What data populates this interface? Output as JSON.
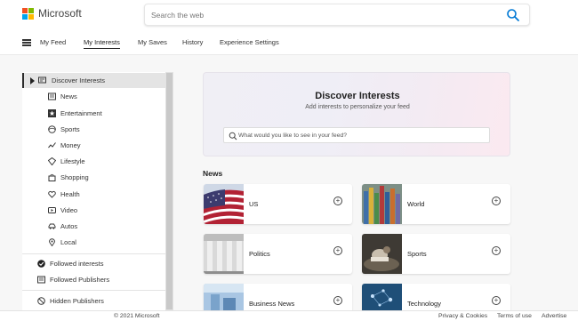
{
  "header": {
    "brand": "Microsoft",
    "search_placeholder": "Search the web"
  },
  "nav": {
    "items": [
      {
        "label": "My Feed",
        "active": false
      },
      {
        "label": "My Interests",
        "active": true
      },
      {
        "label": "My Saves",
        "active": false
      },
      {
        "label": "History",
        "active": false
      },
      {
        "label": "Experience Settings",
        "active": false
      }
    ]
  },
  "sidebar": {
    "items": [
      {
        "label": "Discover Interests",
        "icon": "discover-icon",
        "selected": true
      },
      {
        "label": "News",
        "icon": "news-icon"
      },
      {
        "label": "Entertainment",
        "icon": "star-icon"
      },
      {
        "label": "Sports",
        "icon": "sports-icon"
      },
      {
        "label": "Money",
        "icon": "money-icon"
      },
      {
        "label": "Lifestyle",
        "icon": "lifestyle-icon"
      },
      {
        "label": "Shopping",
        "icon": "shopping-icon"
      },
      {
        "label": "Health",
        "icon": "health-icon"
      },
      {
        "label": "Video",
        "icon": "video-icon"
      },
      {
        "label": "Autos",
        "icon": "autos-icon"
      },
      {
        "label": "Local",
        "icon": "local-icon"
      }
    ],
    "followed_interests": "Followed interests",
    "followed_publishers": "Followed Publishers",
    "hidden_publishers": "Hidden Publishers"
  },
  "hero": {
    "title": "Discover Interests",
    "subtitle": "Add interests to personalize your feed",
    "search_placeholder": "What would you like to see in your feed?"
  },
  "news": {
    "section_title": "News",
    "cards": [
      {
        "label": "US"
      },
      {
        "label": "World"
      },
      {
        "label": "Politics"
      },
      {
        "label": "Sports"
      },
      {
        "label": "Business News"
      },
      {
        "label": "Technology"
      }
    ]
  },
  "footer": {
    "copyright": "© 2021 Microsoft",
    "privacy": "Privacy & Cookies",
    "terms": "Terms of use",
    "advertise": "Advertise"
  },
  "colors": {
    "accent": "#0078d4",
    "logo_red": "#f25022",
    "logo_green": "#7fba00",
    "logo_blue": "#00a4ef",
    "logo_yellow": "#ffb900"
  }
}
